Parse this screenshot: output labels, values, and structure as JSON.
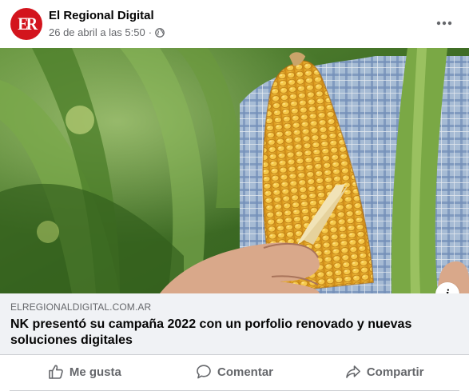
{
  "post": {
    "author": "El Regional Digital",
    "avatar_text": "ER",
    "timestamp": "26 de abril a las 5:50",
    "separator": "·",
    "privacy_icon": "globe-icon",
    "more_icon": "more-horizontal-icon"
  },
  "image": {
    "description_icon": "info-icon",
    "info_label": "i"
  },
  "link": {
    "domain": "ELREGIONALDIGITAL.COM.AR",
    "title": "NK presentó su campaña 2022 con un porfolio renovado y nuevas soluciones digitales"
  },
  "actions": {
    "like_label": "Me gusta",
    "comment_label": "Comentar",
    "share_label": "Compartir",
    "like_icon": "thumbs-up-icon",
    "comment_icon": "comment-icon",
    "share_icon": "share-icon"
  },
  "colors": {
    "brand_red": "#d3141d",
    "secondary_text": "#65676b",
    "link_background": "#f0f2f5"
  }
}
